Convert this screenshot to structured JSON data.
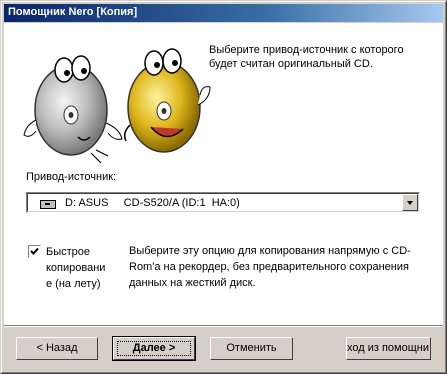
{
  "window": {
    "title": "Помощник Nero [Копия]"
  },
  "intro_text": "Выберите привод-источник с которого будет считан оригинальный CD.",
  "source_drive": {
    "label": "Привод-источник:",
    "selected": "D: ASUS     CD-S520/A (ID:1  HA:0)",
    "icon": "cd-drive-icon"
  },
  "quick_copy": {
    "checked": true,
    "label": "Быстрое копировани е (на лету)",
    "description": "Выберите эту опцию для копирования напрямую с CD-Rom'a на рекордер, без предварительного сохранения данных на жесткий диск."
  },
  "buttons": {
    "back": "< Назад",
    "next": "Далее >",
    "cancel": "Отменить",
    "exit_wizard": "ход из помощни"
  },
  "colors": {
    "titlebar_start": "#0a246a",
    "titlebar_end": "#a6caf0",
    "face": "#d4d0c8",
    "panel": "#ffffff"
  }
}
